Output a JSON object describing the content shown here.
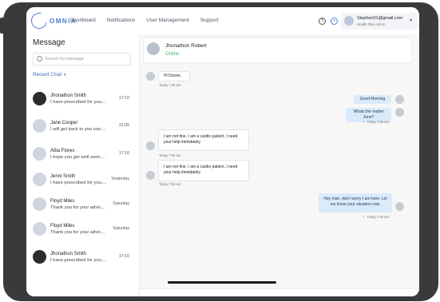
{
  "brand": {
    "logo_text": "OMNIA"
  },
  "nav": {
    "items": [
      "Dashboard",
      "Notifications",
      "User Management",
      "Support"
    ]
  },
  "header": {
    "help_glyph": "?",
    "chat_glyph": "•",
    "user_email": "Stephen01@gmail.com",
    "user_role": "Health Plan Admin",
    "caret": "▾"
  },
  "sidebar": {
    "title": "Message",
    "search_placeholder": "Search for message",
    "recent_label": "Recent Chat",
    "recent_chevron": "▾",
    "chats": [
      {
        "name": "Jhonathon Smith",
        "preview": "I have prescribed for you....",
        "time": "17:10"
      },
      {
        "name": "Jane Cooper",
        "preview": "I will get back to you soo....",
        "time": "21:05"
      },
      {
        "name": "Alba Flores",
        "preview": "I hope you get well soon....",
        "time": "17:10"
      },
      {
        "name": "Jenni Smith",
        "preview": "I have prescribed for you....",
        "time": "Yesterday"
      },
      {
        "name": "Floyd Miles",
        "preview": "Thank you for your advic...",
        "time": "Saturday"
      },
      {
        "name": "Floyd Miles",
        "preview": "Thank you for your advic...",
        "time": "Saturday"
      },
      {
        "name": "Jhonathon Smith",
        "preview": "I have prescribed for you....",
        "time": "17:10"
      }
    ]
  },
  "conversation": {
    "contact_name": "Jhonathon Robert",
    "status": "Online",
    "messages": [
      {
        "dir": "in",
        "text": "Hi Doctor,",
        "time": "Today 7:45 am"
      },
      {
        "dir": "out",
        "text": "Good Morning",
        "time": ""
      },
      {
        "dir": "out",
        "text": "Whats the matter Jone?",
        "time": "Today 7:55 am"
      },
      {
        "dir": "in",
        "text": "I am not fine. I am a cardio patient. I need your help immidately.",
        "time": "Today 7:59 am"
      },
      {
        "dir": "in",
        "text": "I am not fine. I am a cardio patient. I need your help immidately.",
        "time": "Today 7:59 am"
      },
      {
        "dir": "out",
        "text": "Hey man, don't worry I am here. Let me know your situation now.",
        "time": "Today 7:55 am"
      }
    ],
    "tick": "✓"
  }
}
